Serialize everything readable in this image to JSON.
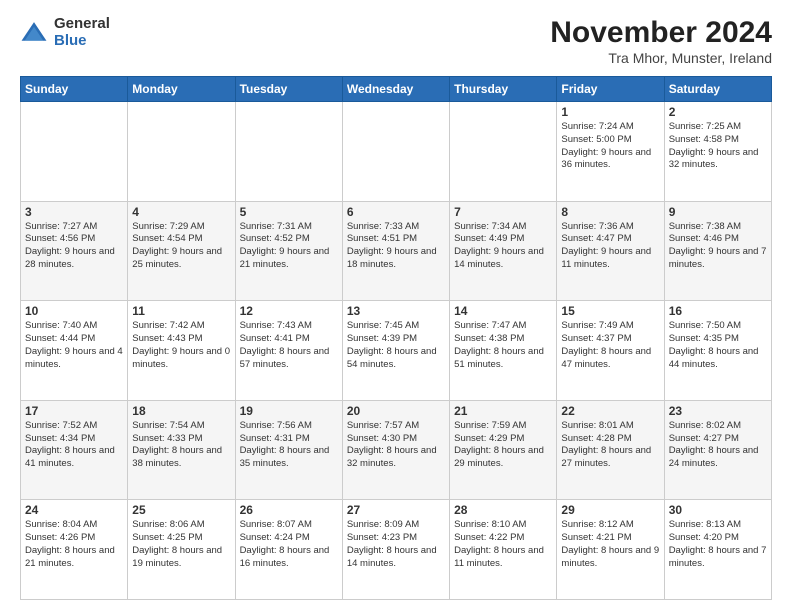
{
  "header": {
    "logo": {
      "general": "General",
      "blue": "Blue"
    },
    "title": "November 2024",
    "subtitle": "Tra Mhor, Munster, Ireland"
  },
  "days_of_week": [
    "Sunday",
    "Monday",
    "Tuesday",
    "Wednesday",
    "Thursday",
    "Friday",
    "Saturday"
  ],
  "weeks": [
    [
      null,
      null,
      null,
      null,
      null,
      {
        "day": "1",
        "sunrise": "Sunrise: 7:24 AM",
        "sunset": "Sunset: 5:00 PM",
        "daylight": "Daylight: 9 hours and 36 minutes."
      },
      {
        "day": "2",
        "sunrise": "Sunrise: 7:25 AM",
        "sunset": "Sunset: 4:58 PM",
        "daylight": "Daylight: 9 hours and 32 minutes."
      }
    ],
    [
      {
        "day": "3",
        "sunrise": "Sunrise: 7:27 AM",
        "sunset": "Sunset: 4:56 PM",
        "daylight": "Daylight: 9 hours and 28 minutes."
      },
      {
        "day": "4",
        "sunrise": "Sunrise: 7:29 AM",
        "sunset": "Sunset: 4:54 PM",
        "daylight": "Daylight: 9 hours and 25 minutes."
      },
      {
        "day": "5",
        "sunrise": "Sunrise: 7:31 AM",
        "sunset": "Sunset: 4:52 PM",
        "daylight": "Daylight: 9 hours and 21 minutes."
      },
      {
        "day": "6",
        "sunrise": "Sunrise: 7:33 AM",
        "sunset": "Sunset: 4:51 PM",
        "daylight": "Daylight: 9 hours and 18 minutes."
      },
      {
        "day": "7",
        "sunrise": "Sunrise: 7:34 AM",
        "sunset": "Sunset: 4:49 PM",
        "daylight": "Daylight: 9 hours and 14 minutes."
      },
      {
        "day": "8",
        "sunrise": "Sunrise: 7:36 AM",
        "sunset": "Sunset: 4:47 PM",
        "daylight": "Daylight: 9 hours and 11 minutes."
      },
      {
        "day": "9",
        "sunrise": "Sunrise: 7:38 AM",
        "sunset": "Sunset: 4:46 PM",
        "daylight": "Daylight: 9 hours and 7 minutes."
      }
    ],
    [
      {
        "day": "10",
        "sunrise": "Sunrise: 7:40 AM",
        "sunset": "Sunset: 4:44 PM",
        "daylight": "Daylight: 9 hours and 4 minutes."
      },
      {
        "day": "11",
        "sunrise": "Sunrise: 7:42 AM",
        "sunset": "Sunset: 4:43 PM",
        "daylight": "Daylight: 9 hours and 0 minutes."
      },
      {
        "day": "12",
        "sunrise": "Sunrise: 7:43 AM",
        "sunset": "Sunset: 4:41 PM",
        "daylight": "Daylight: 8 hours and 57 minutes."
      },
      {
        "day": "13",
        "sunrise": "Sunrise: 7:45 AM",
        "sunset": "Sunset: 4:39 PM",
        "daylight": "Daylight: 8 hours and 54 minutes."
      },
      {
        "day": "14",
        "sunrise": "Sunrise: 7:47 AM",
        "sunset": "Sunset: 4:38 PM",
        "daylight": "Daylight: 8 hours and 51 minutes."
      },
      {
        "day": "15",
        "sunrise": "Sunrise: 7:49 AM",
        "sunset": "Sunset: 4:37 PM",
        "daylight": "Daylight: 8 hours and 47 minutes."
      },
      {
        "day": "16",
        "sunrise": "Sunrise: 7:50 AM",
        "sunset": "Sunset: 4:35 PM",
        "daylight": "Daylight: 8 hours and 44 minutes."
      }
    ],
    [
      {
        "day": "17",
        "sunrise": "Sunrise: 7:52 AM",
        "sunset": "Sunset: 4:34 PM",
        "daylight": "Daylight: 8 hours and 41 minutes."
      },
      {
        "day": "18",
        "sunrise": "Sunrise: 7:54 AM",
        "sunset": "Sunset: 4:33 PM",
        "daylight": "Daylight: 8 hours and 38 minutes."
      },
      {
        "day": "19",
        "sunrise": "Sunrise: 7:56 AM",
        "sunset": "Sunset: 4:31 PM",
        "daylight": "Daylight: 8 hours and 35 minutes."
      },
      {
        "day": "20",
        "sunrise": "Sunrise: 7:57 AM",
        "sunset": "Sunset: 4:30 PM",
        "daylight": "Daylight: 8 hours and 32 minutes."
      },
      {
        "day": "21",
        "sunrise": "Sunrise: 7:59 AM",
        "sunset": "Sunset: 4:29 PM",
        "daylight": "Daylight: 8 hours and 29 minutes."
      },
      {
        "day": "22",
        "sunrise": "Sunrise: 8:01 AM",
        "sunset": "Sunset: 4:28 PM",
        "daylight": "Daylight: 8 hours and 27 minutes."
      },
      {
        "day": "23",
        "sunrise": "Sunrise: 8:02 AM",
        "sunset": "Sunset: 4:27 PM",
        "daylight": "Daylight: 8 hours and 24 minutes."
      }
    ],
    [
      {
        "day": "24",
        "sunrise": "Sunrise: 8:04 AM",
        "sunset": "Sunset: 4:26 PM",
        "daylight": "Daylight: 8 hours and 21 minutes."
      },
      {
        "day": "25",
        "sunrise": "Sunrise: 8:06 AM",
        "sunset": "Sunset: 4:25 PM",
        "daylight": "Daylight: 8 hours and 19 minutes."
      },
      {
        "day": "26",
        "sunrise": "Sunrise: 8:07 AM",
        "sunset": "Sunset: 4:24 PM",
        "daylight": "Daylight: 8 hours and 16 minutes."
      },
      {
        "day": "27",
        "sunrise": "Sunrise: 8:09 AM",
        "sunset": "Sunset: 4:23 PM",
        "daylight": "Daylight: 8 hours and 14 minutes."
      },
      {
        "day": "28",
        "sunrise": "Sunrise: 8:10 AM",
        "sunset": "Sunset: 4:22 PM",
        "daylight": "Daylight: 8 hours and 11 minutes."
      },
      {
        "day": "29",
        "sunrise": "Sunrise: 8:12 AM",
        "sunset": "Sunset: 4:21 PM",
        "daylight": "Daylight: 8 hours and 9 minutes."
      },
      {
        "day": "30",
        "sunrise": "Sunrise: 8:13 AM",
        "sunset": "Sunset: 4:20 PM",
        "daylight": "Daylight: 8 hours and 7 minutes."
      }
    ]
  ]
}
